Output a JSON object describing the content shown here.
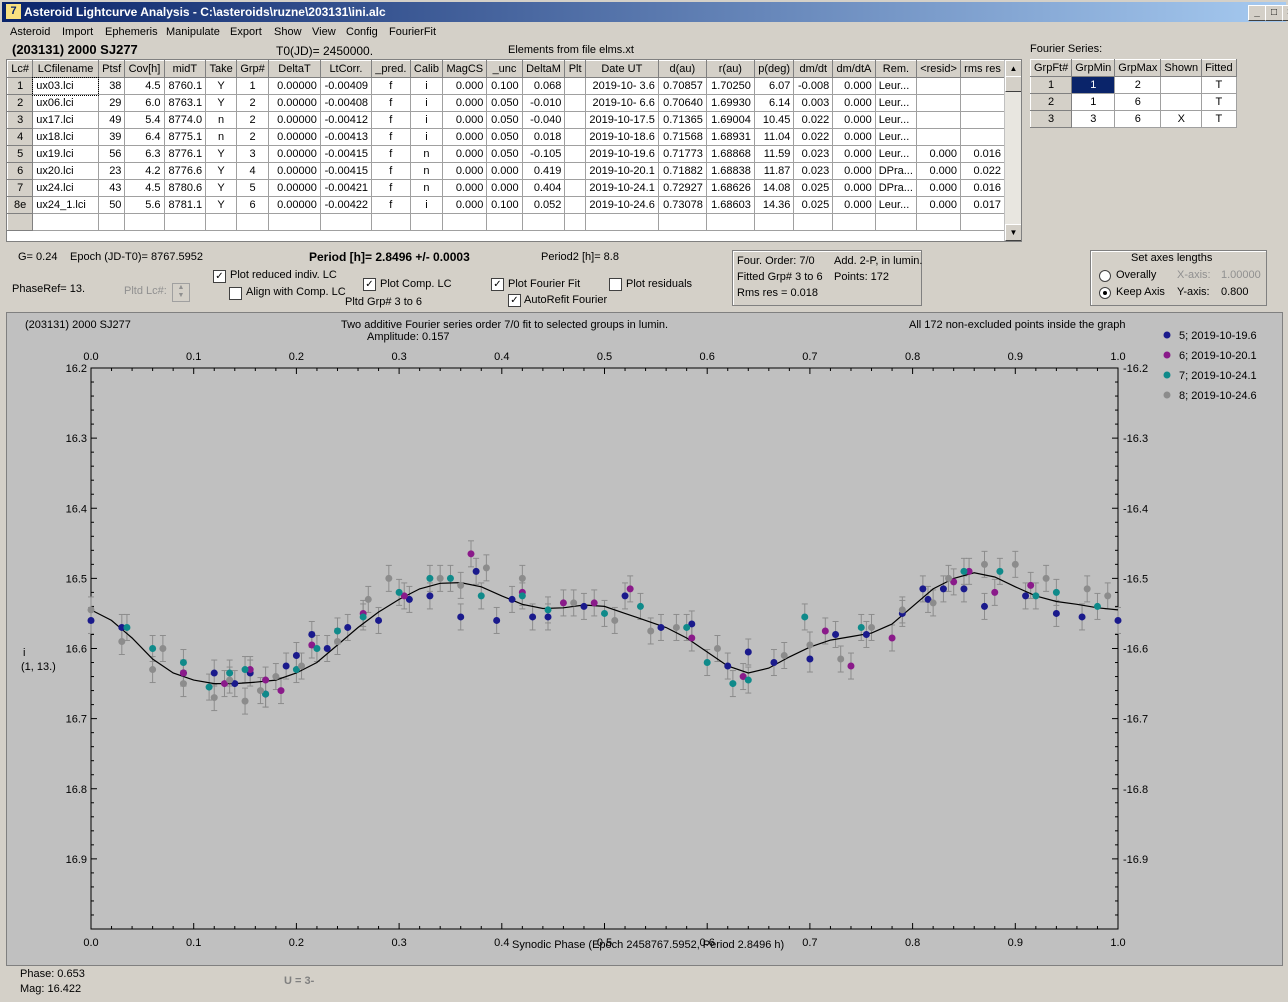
{
  "window": {
    "title": "Asteroid Lightcurve Analysis - C:\\asteroids\\ruzne\\203131\\ini.alc",
    "icon_text": "7",
    "min_glyph": "_",
    "max_glyph": "□",
    "close_glyph": "×"
  },
  "menu": [
    "Asteroid",
    "Import",
    "Ephemeris",
    "Manipulate",
    "Export",
    "Show",
    "View",
    "Config",
    "FourierFit"
  ],
  "header": {
    "asteroid": "(203131) 2000 SJ277",
    "t0": "T0(JD)= 2450000.",
    "elements": "Elements from file elms.xt"
  },
  "lc_table": {
    "columns": [
      "Lc#",
      "LCfilename",
      "Ptsf",
      "Cov[h]",
      "midT",
      "Take",
      "Grp#",
      "DeltaT",
      "LtCorr.",
      "_pred.",
      "Calib",
      "MagCS",
      "_unc",
      "DeltaM",
      "Plt",
      "Date UT",
      "d(au)",
      "r(au)",
      "p(deg)",
      "dm/dt",
      "dm/dtA",
      "Rem.",
      "<resid>",
      "rms res"
    ],
    "rows": [
      [
        "1",
        "ux03.lci",
        "38",
        "4.5",
        "8760.1",
        "Y",
        "1",
        "0.00000",
        "-0.00409",
        "f",
        "i",
        "0.000",
        "0.100",
        "0.068",
        "",
        "2019-10- 3.6",
        "0.70857",
        "1.70250",
        "6.07",
        "-0.008",
        "0.000",
        "Leur...",
        "",
        ""
      ],
      [
        "2",
        "ux06.lci",
        "29",
        "6.0",
        "8763.1",
        "Y",
        "2",
        "0.00000",
        "-0.00408",
        "f",
        "i",
        "0.000",
        "0.050",
        "-0.010",
        "",
        "2019-10- 6.6",
        "0.70640",
        "1.69930",
        "6.14",
        "0.003",
        "0.000",
        "Leur...",
        "",
        ""
      ],
      [
        "3",
        "ux17.lci",
        "49",
        "5.4",
        "8774.0",
        "n",
        "2",
        "0.00000",
        "-0.00412",
        "f",
        "i",
        "0.000",
        "0.050",
        "-0.040",
        "",
        "2019-10-17.5",
        "0.71365",
        "1.69004",
        "10.45",
        "0.022",
        "0.000",
        "Leur...",
        "",
        ""
      ],
      [
        "4",
        "ux18.lci",
        "39",
        "6.4",
        "8775.1",
        "n",
        "2",
        "0.00000",
        "-0.00413",
        "f",
        "i",
        "0.000",
        "0.050",
        "0.018",
        "",
        "2019-10-18.6",
        "0.71568",
        "1.68931",
        "11.04",
        "0.022",
        "0.000",
        "Leur...",
        "",
        ""
      ],
      [
        "5",
        "ux19.lci",
        "56",
        "6.3",
        "8776.1",
        "Y",
        "3",
        "0.00000",
        "-0.00415",
        "f",
        "n",
        "0.000",
        "0.050",
        "-0.105",
        "",
        "2019-10-19.6",
        "0.71773",
        "1.68868",
        "11.59",
        "0.023",
        "0.000",
        "Leur...",
        "0.000",
        "0.016"
      ],
      [
        "6",
        "ux20.lci",
        "23",
        "4.2",
        "8776.6",
        "Y",
        "4",
        "0.00000",
        "-0.00415",
        "f",
        "n",
        "0.000",
        "0.000",
        "0.419",
        "",
        "2019-10-20.1",
        "0.71882",
        "1.68838",
        "11.87",
        "0.023",
        "0.000",
        "DPra...",
        "0.000",
        "0.022"
      ],
      [
        "7",
        "ux24.lci",
        "43",
        "4.5",
        "8780.6",
        "Y",
        "5",
        "0.00000",
        "-0.00421",
        "f",
        "n",
        "0.000",
        "0.000",
        "0.404",
        "",
        "2019-10-24.1",
        "0.72927",
        "1.68626",
        "14.08",
        "0.025",
        "0.000",
        "DPra...",
        "0.000",
        "0.016"
      ],
      [
        "8e",
        "ux24_1.lci",
        "50",
        "5.6",
        "8781.1",
        "Y",
        "6",
        "0.00000",
        "-0.00422",
        "f",
        "i",
        "0.000",
        "0.100",
        "0.052",
        "",
        "2019-10-24.6",
        "0.73078",
        "1.68603",
        "14.36",
        "0.025",
        "0.000",
        "Leur...",
        "0.000",
        "0.017"
      ]
    ]
  },
  "fourier_series": {
    "title": "Fourier Series:",
    "columns": [
      "GrpFt#",
      "GrpMin",
      "GrpMax",
      "Shown",
      "Fitted"
    ],
    "rows": [
      [
        "1",
        "1",
        "2",
        "",
        "T"
      ],
      [
        "2",
        "1",
        "6",
        "",
        "T"
      ],
      [
        "3",
        "3",
        "6",
        "X",
        "T"
      ]
    ]
  },
  "info": {
    "g": "G= 0.24",
    "epoch": "Epoch (JD-T0)= 8767.5952",
    "period": "Period [h]= 2.8496 +/- 0.0003",
    "period2": "Period2 [h]= 8.8",
    "phaseref": "PhaseRef= 13.",
    "pltd_lc": "Pltd Lc#:",
    "plot_reduced": "Plot reduced indiv. LC",
    "align_comp": "Align with Comp. LC",
    "plot_comp": "Plot Comp. LC",
    "pltd_grp": "Pltd Grp#  3  to   6",
    "plot_fourier": "Plot Fourier Fit",
    "autorefit": "AutoRefit Fourier",
    "plot_residuals": "Plot residuals",
    "four_order": "Four. Order:  7/0",
    "add2p": "Add. 2-P, in lumin.",
    "fitted_grp": "Fitted Grp# 3 to 6",
    "points": "Points: 172",
    "rms_res": "Rms res     = 0.018"
  },
  "axes_box": {
    "title": "Set axes lengths",
    "overally": "Overally",
    "keep_axis": "Keep Axis",
    "xaxis_label": "X-axis:",
    "xaxis_value": "1.00000",
    "yaxis_label": "Y-axis:",
    "yaxis_value": "0.800"
  },
  "plot_texts": {
    "name": "(203131) 2000 SJ277",
    "desc1": "Two additive Fourier series order 7/0 fit to selected groups in lumin.",
    "desc2": "Amplitude: 0.157",
    "allpts": "All 172 non-excluded points inside the graph",
    "ylab1": "i",
    "ylab2": "(1, 13.)",
    "xlabel": "Synodic Phase (Epoch 2458767.5952, Period 2.8496 h)"
  },
  "footer": {
    "phase": "Phase:  0.653",
    "mag": "Mag:   16.422",
    "u": "U = 3-"
  },
  "chart_data": {
    "type": "scatter",
    "xlim": [
      0.0,
      1.0
    ],
    "ylim": [
      16.2,
      17.0
    ],
    "y_inverted": true,
    "xticks": [
      "0.0",
      "0.1",
      "0.2",
      "0.3",
      "0.4",
      "0.5",
      "0.6",
      "0.7",
      "0.8",
      "0.9",
      "1.0"
    ],
    "yticks": [
      "16.2",
      "16.3",
      "16.4",
      "16.5",
      "16.6",
      "16.7",
      "16.8",
      "16.9"
    ],
    "fit_curve": {
      "color": "#000000",
      "x": [
        0.0,
        0.02,
        0.04,
        0.06,
        0.08,
        0.1,
        0.12,
        0.14,
        0.16,
        0.18,
        0.2,
        0.22,
        0.24,
        0.26,
        0.28,
        0.3,
        0.32,
        0.34,
        0.36,
        0.38,
        0.4,
        0.42,
        0.44,
        0.46,
        0.48,
        0.5,
        0.52,
        0.54,
        0.56,
        0.58,
        0.6,
        0.62,
        0.64,
        0.66,
        0.68,
        0.7,
        0.72,
        0.74,
        0.76,
        0.78,
        0.8,
        0.82,
        0.84,
        0.86,
        0.88,
        0.9,
        0.92,
        0.94,
        0.96,
        0.98,
        1.0
      ],
      "y": [
        16.545,
        16.56,
        16.585,
        16.615,
        16.635,
        16.645,
        16.65,
        16.65,
        16.648,
        16.645,
        16.635,
        16.62,
        16.595,
        16.57,
        16.548,
        16.53,
        16.515,
        16.507,
        16.506,
        16.512,
        16.525,
        16.537,
        16.543,
        16.542,
        16.538,
        16.54,
        16.55,
        16.56,
        16.57,
        16.585,
        16.605,
        16.625,
        16.635,
        16.628,
        16.612,
        16.598,
        16.588,
        16.583,
        16.578,
        16.565,
        16.54,
        16.515,
        16.5,
        16.492,
        16.498,
        16.512,
        16.525,
        16.533,
        16.537,
        16.542,
        16.545
      ]
    },
    "series": [
      {
        "name": "5; 2019-10-19.6",
        "color": "#1a1a8c",
        "x": [
          0.0,
          0.03,
          0.09,
          0.12,
          0.14,
          0.155,
          0.17,
          0.19,
          0.2,
          0.215,
          0.23,
          0.25,
          0.28,
          0.31,
          0.33,
          0.36,
          0.375,
          0.395,
          0.41,
          0.43,
          0.445,
          0.48,
          0.52,
          0.555,
          0.585,
          0.62,
          0.64,
          0.665,
          0.7,
          0.725,
          0.755,
          0.79,
          0.81,
          0.815,
          0.83,
          0.85,
          0.87,
          0.91,
          0.94,
          0.965,
          1.0
        ],
        "y": [
          16.56,
          16.57,
          16.635,
          16.635,
          16.65,
          16.635,
          16.665,
          16.625,
          16.61,
          16.58,
          16.6,
          16.57,
          16.56,
          16.53,
          16.525,
          16.555,
          16.49,
          16.56,
          16.53,
          16.555,
          16.555,
          16.54,
          16.525,
          16.57,
          16.565,
          16.625,
          16.605,
          16.62,
          16.615,
          16.58,
          16.58,
          16.55,
          16.515,
          16.53,
          16.515,
          16.515,
          16.54,
          16.525,
          16.55,
          16.555,
          16.56
        ]
      },
      {
        "name": "6; 2019-10-20.1",
        "color": "#8a1a8a",
        "x": [
          0.09,
          0.13,
          0.155,
          0.17,
          0.185,
          0.215,
          0.265,
          0.305,
          0.37,
          0.42,
          0.46,
          0.49,
          0.525,
          0.585,
          0.635,
          0.715,
          0.74,
          0.78,
          0.84,
          0.855,
          0.88,
          0.915
        ],
        "y": [
          16.635,
          16.65,
          16.63,
          16.645,
          16.66,
          16.595,
          16.55,
          16.525,
          16.465,
          16.52,
          16.535,
          16.535,
          16.515,
          16.585,
          16.64,
          16.575,
          16.625,
          16.585,
          16.505,
          16.49,
          16.52,
          16.51
        ]
      },
      {
        "name": "7; 2019-10-24.1",
        "color": "#0f8a8a",
        "x": [
          0.035,
          0.06,
          0.09,
          0.115,
          0.135,
          0.15,
          0.17,
          0.2,
          0.22,
          0.24,
          0.265,
          0.3,
          0.33,
          0.35,
          0.38,
          0.42,
          0.445,
          0.5,
          0.535,
          0.58,
          0.6,
          0.625,
          0.64,
          0.695,
          0.75,
          0.85,
          0.885,
          0.92,
          0.94,
          0.98
        ],
        "y": [
          16.57,
          16.6,
          16.62,
          16.655,
          16.635,
          16.63,
          16.665,
          16.63,
          16.6,
          16.575,
          16.555,
          16.52,
          16.5,
          16.5,
          16.525,
          16.525,
          16.545,
          16.55,
          16.54,
          16.57,
          16.62,
          16.65,
          16.645,
          16.555,
          16.57,
          16.49,
          16.49,
          16.525,
          16.52,
          16.54
        ]
      },
      {
        "name": "8; 2019-10-24.6",
        "color": "#8c8c8c",
        "x": [
          0.0,
          0.03,
          0.06,
          0.07,
          0.09,
          0.12,
          0.135,
          0.15,
          0.165,
          0.18,
          0.205,
          0.24,
          0.27,
          0.29,
          0.34,
          0.36,
          0.385,
          0.42,
          0.47,
          0.51,
          0.545,
          0.57,
          0.61,
          0.675,
          0.7,
          0.73,
          0.76,
          0.79,
          0.82,
          0.835,
          0.87,
          0.9,
          0.93,
          0.97,
          0.99
        ],
        "y": [
          16.545,
          16.59,
          16.63,
          16.6,
          16.65,
          16.67,
          16.645,
          16.675,
          16.66,
          16.64,
          16.625,
          16.59,
          16.53,
          16.5,
          16.5,
          16.51,
          16.485,
          16.5,
          16.535,
          16.56,
          16.575,
          16.57,
          16.6,
          16.61,
          16.595,
          16.615,
          16.57,
          16.545,
          16.535,
          16.5,
          16.48,
          16.48,
          16.5,
          16.515,
          16.525
        ]
      }
    ]
  }
}
